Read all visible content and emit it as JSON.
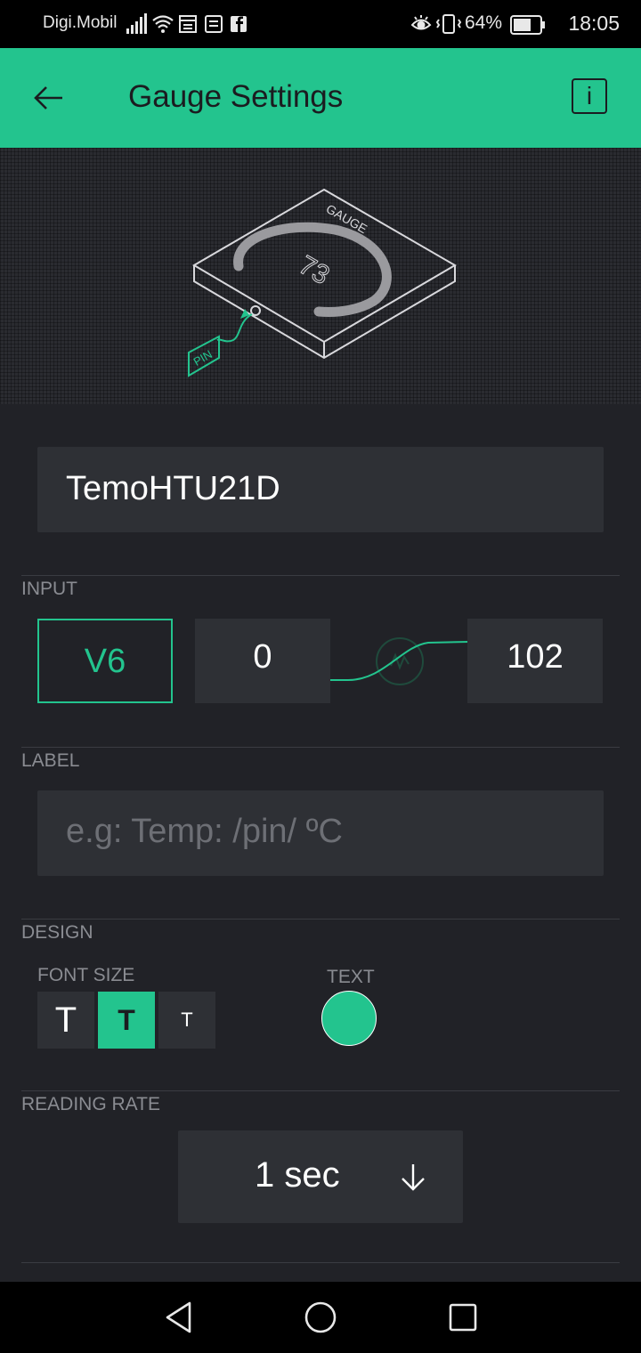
{
  "status_bar": {
    "carrier": "Digi.Mobil",
    "battery_percent": "64%",
    "time": "18:05",
    "icons_left": [
      "signal-icon",
      "wifi-icon",
      "calendar-icon",
      "news-icon",
      "facebook-icon"
    ],
    "icons_right": [
      "eye-comfort-icon",
      "vibrate-icon",
      "battery-icon"
    ]
  },
  "header": {
    "title": "Gauge Settings",
    "info_label": "i"
  },
  "illustration": {
    "gauge_label": "GAUGE",
    "gauge_value": "73",
    "pin_label": "PIN"
  },
  "name_field": {
    "value": "TemoHTU21D"
  },
  "input": {
    "section_label": "INPUT",
    "pin": "V6",
    "min": "0",
    "max": "102"
  },
  "label": {
    "section_label": "LABEL",
    "placeholder": "e.g: Temp: /pin/ ºC"
  },
  "design": {
    "section_label": "DESIGN",
    "font_size_label": "FONT SIZE",
    "font_sizes": [
      "T",
      "T",
      "T"
    ],
    "selected_font_size": 1,
    "text_color_label": "TEXT",
    "text_color": "#23c48e"
  },
  "reading_rate": {
    "section_label": "READING RATE",
    "value": "1 sec"
  },
  "colors": {
    "accent": "#23c48e",
    "background": "#212227",
    "field": "#2e3035"
  }
}
